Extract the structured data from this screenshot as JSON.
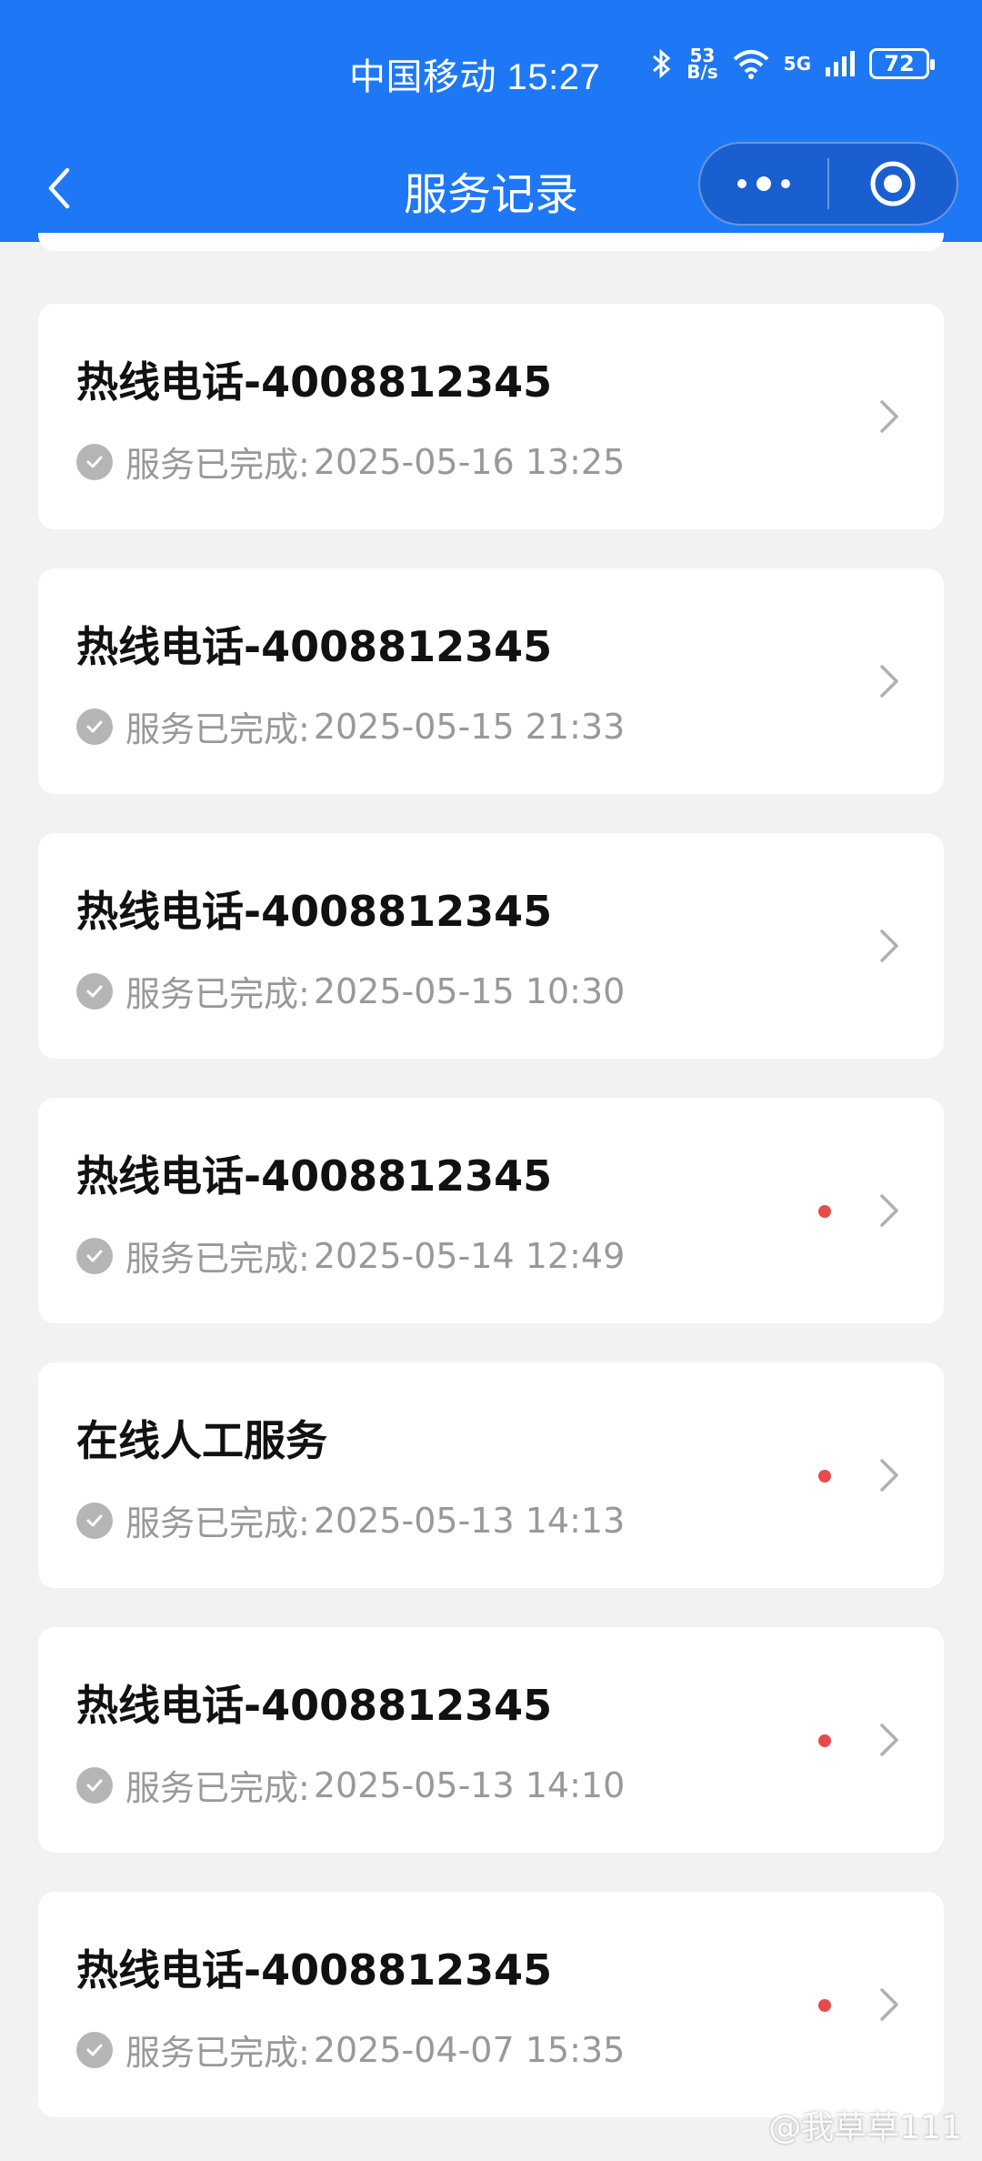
{
  "status_bar": {
    "carrier": "中国移动",
    "time": "15:27",
    "net_speed_value": "53",
    "net_speed_unit": "B/s",
    "network_type": "5G",
    "battery": "72",
    "icons": [
      "bluetooth-icon",
      "wifi-icon",
      "signal-icon",
      "battery-icon"
    ]
  },
  "nav": {
    "title": "服务记录",
    "back_icon": "chevron-left-icon",
    "more_icon": "more-dots-icon",
    "close_icon": "target-circle-icon"
  },
  "colors": {
    "header_bg": "#1e78f6",
    "page_bg": "#f2f2f2",
    "card_bg": "#ffffff",
    "unread_dot": "#e84a4a",
    "status_text": "#999999"
  },
  "records": [
    {
      "title": "热线电话-4008812345",
      "status_label": "服务已完成:",
      "time": "2025-05-16 13:25",
      "unread": false
    },
    {
      "title": "热线电话-4008812345",
      "status_label": "服务已完成:",
      "time": "2025-05-15 21:33",
      "unread": false
    },
    {
      "title": "热线电话-4008812345",
      "status_label": "服务已完成:",
      "time": "2025-05-15 10:30",
      "unread": false
    },
    {
      "title": "热线电话-4008812345",
      "status_label": "服务已完成:",
      "time": "2025-05-14 12:49",
      "unread": true
    },
    {
      "title": "在线人工服务",
      "status_label": "服务已完成:",
      "time": "2025-05-13 14:13",
      "unread": true
    },
    {
      "title": "热线电话-4008812345",
      "status_label": "服务已完成:",
      "time": "2025-05-13 14:10",
      "unread": true
    },
    {
      "title": "热线电话-4008812345",
      "status_label": "服务已完成:",
      "time": "2025-04-07 15:35",
      "unread": true
    }
  ],
  "watermark": "@我草草111"
}
